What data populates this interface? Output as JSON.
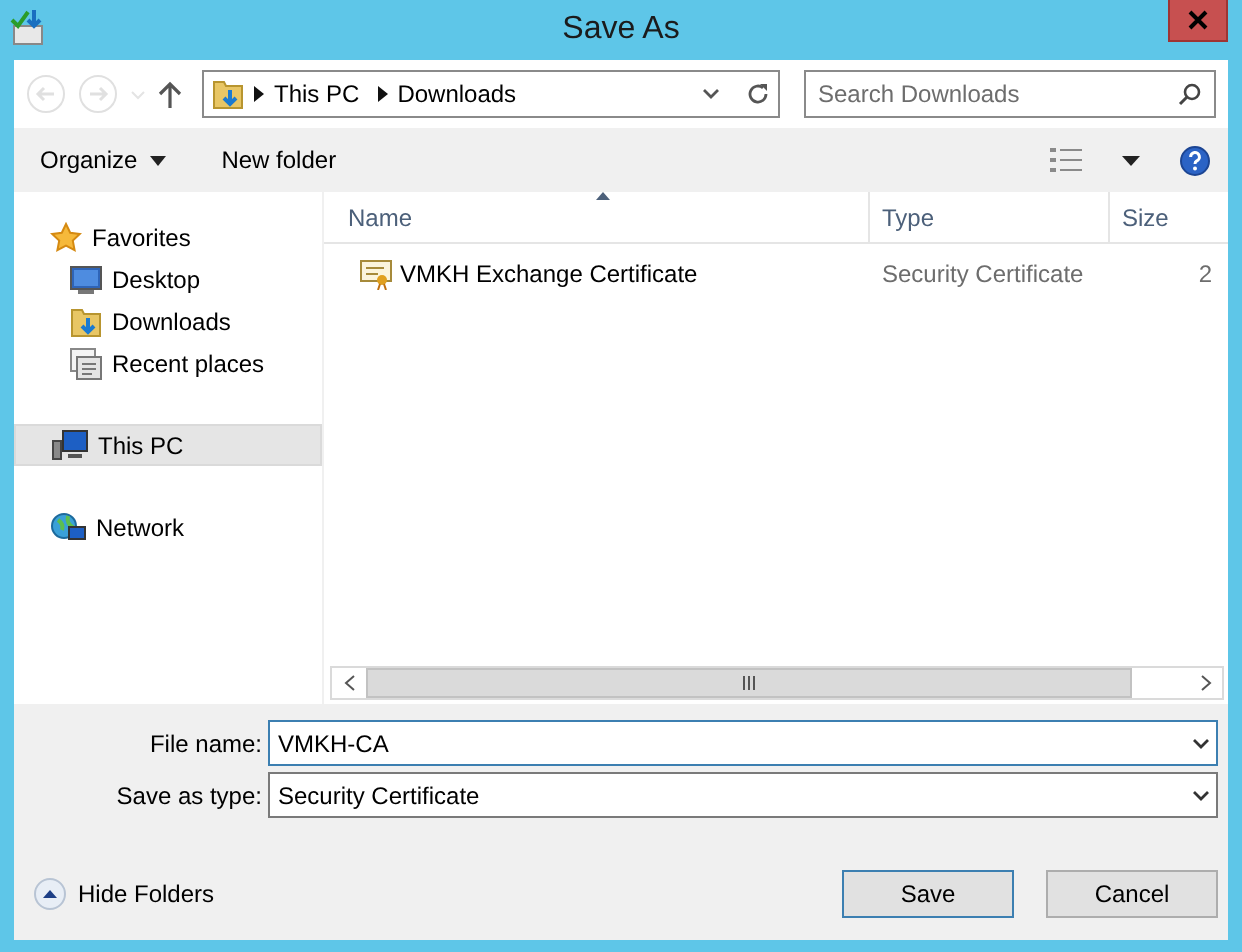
{
  "window": {
    "title": "Save As"
  },
  "address": {
    "path": [
      {
        "label": "This PC"
      },
      {
        "label": "Downloads"
      }
    ]
  },
  "search": {
    "placeholder": "Search Downloads"
  },
  "toolbar": {
    "organize": "Organize",
    "new_folder": "New folder"
  },
  "nav": [
    {
      "label": "Favorites",
      "kind": "favorites",
      "selected": false,
      "children": [
        {
          "label": "Desktop",
          "kind": "desktop",
          "selected": false
        },
        {
          "label": "Downloads",
          "kind": "downloads",
          "selected": false
        },
        {
          "label": "Recent places",
          "kind": "recent",
          "selected": false
        }
      ]
    },
    {
      "label": "This PC",
      "kind": "pc",
      "selected": true
    },
    {
      "label": "Network",
      "kind": "network",
      "selected": false
    }
  ],
  "columns": [
    "Name",
    "Type",
    "Size"
  ],
  "files": [
    {
      "name": "VMKH Exchange Certificate",
      "type": "Security Certificate",
      "size": "2"
    }
  ],
  "form": [
    {
      "label": "File name:",
      "value": "VMKH-CA",
      "focused": true
    },
    {
      "label": "Save as type:",
      "value": "Security Certificate",
      "focused": false
    }
  ],
  "hide_folders": "Hide Folders",
  "buttons": [
    {
      "label": "Save",
      "default": true
    },
    {
      "label": "Cancel",
      "default": false
    }
  ]
}
